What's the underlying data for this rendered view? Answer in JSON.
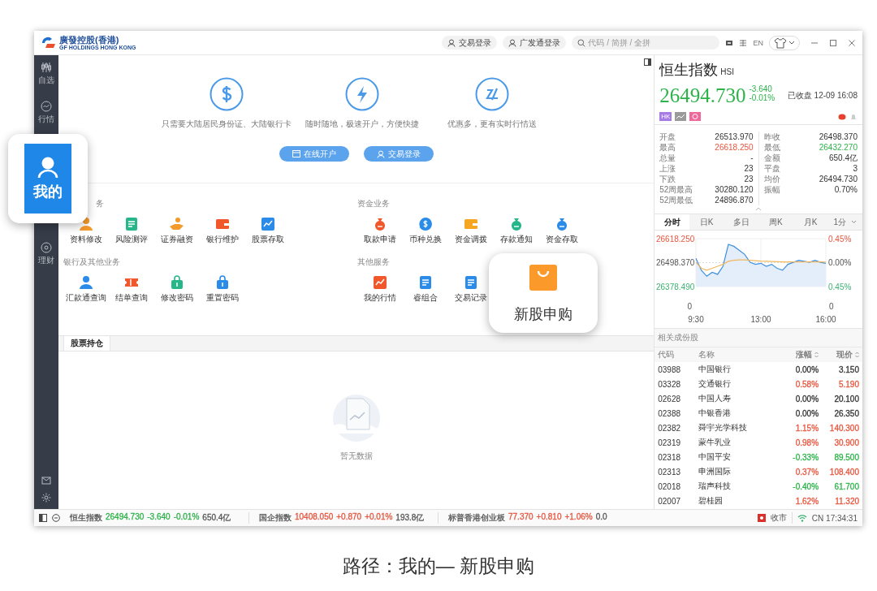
{
  "title_bar": {
    "logo": "廣發控股(香港)",
    "logo_sub": "GF HOLDINGS HONG KONG",
    "buttons": [
      "交易登录",
      "广发通登录"
    ],
    "search": {
      "placeholder": "代码 / 简拼 / 全拼"
    },
    "language": "EN"
  },
  "sidebar": {
    "items": [
      {
        "label": "自选"
      },
      {
        "label": "行情"
      },
      {
        "label": "理财"
      }
    ]
  },
  "promo": {
    "features": [
      {
        "text": "只需要大陆居民身份证、大陆银行卡"
      },
      {
        "text": "随时随地，极速开户，方便快捷"
      },
      {
        "text": "优惠多，更有实时行情送"
      }
    ],
    "buttons": [
      {
        "label": "在线开户"
      },
      {
        "label": "交易登录"
      }
    ]
  },
  "services": {
    "columns": [
      {
        "sections": [
          {
            "title": "务",
            "items": [
              {
                "label": "资料修改",
                "kind": "person",
                "color": "#f39a2c"
              },
              {
                "label": "风险测评",
                "kind": "doc",
                "color": "#27b58a"
              },
              {
                "label": "证券融资",
                "kind": "hand",
                "color": "#f39a2c"
              },
              {
                "label": "银行维护",
                "kind": "wallet",
                "color": "#f0582c"
              },
              {
                "label": "股票存取",
                "kind": "chart",
                "color": "#2a8be8"
              }
            ]
          },
          {
            "title": "银行及其他业务",
            "items": [
              {
                "label": "汇款通查询",
                "kind": "person",
                "color": "#2a8be8"
              },
              {
                "label": "结单查询",
                "kind": "ticket",
                "color": "#f0582c"
              },
              {
                "label": "修改密码",
                "kind": "lock",
                "color": "#27b58a"
              },
              {
                "label": "重置密码",
                "kind": "lock",
                "color": "#2a8be8"
              }
            ]
          }
        ]
      },
      {
        "sections": [
          {
            "title": "资金业务",
            "items": [
              {
                "label": "取款申请",
                "kind": "bag",
                "color": "#f0582c"
              },
              {
                "label": "币种兑换",
                "kind": "coin",
                "color": "#2a8be8"
              },
              {
                "label": "资金调拨",
                "kind": "wallet",
                "color": "#f5a623"
              },
              {
                "label": "存款通知",
                "kind": "bag",
                "color": "#27b58a"
              },
              {
                "label": "资金存取",
                "kind": "bag",
                "color": "#2a8be8"
              }
            ]
          },
          {
            "title": "其他服务",
            "items": [
              {
                "label": "我的行情",
                "kind": "chart",
                "color": "#f0582c"
              },
              {
                "label": "睿组合",
                "kind": "doc",
                "color": "#2a8be8"
              },
              {
                "label": "交易记录",
                "kind": "doc",
                "color": "#2a8be8"
              }
            ]
          }
        ]
      }
    ]
  },
  "holdings": {
    "tabs": [
      {
        "label": "股票持仓",
        "selected": true
      }
    ],
    "empty_text": "暂无数据"
  },
  "index": {
    "name": "恒生指数",
    "code": "HSI",
    "price": "26494.730",
    "change": "-3.640",
    "pct": "-0.01%",
    "color": "#2db34a",
    "status": "已收盘 12-09 16:08",
    "badges": [
      {
        "kind": "text",
        "label": "HK",
        "color": "#a77be6"
      },
      {
        "kind": "chart",
        "color": "#9a9a9a"
      },
      {
        "kind": "ring",
        "color": "#f0689a"
      }
    ],
    "stats": [
      [
        {
          "label": "开盘",
          "value": "26513.970"
        },
        {
          "label": "最高",
          "value": "26618.250",
          "color": "#e8553e"
        },
        {
          "label": "总量",
          "value": "-"
        },
        {
          "label": "上涨",
          "value": "23"
        },
        {
          "label": "下跌",
          "value": "23"
        },
        {
          "label": "52周最高",
          "value": "30280.120"
        },
        {
          "label": "52周最低",
          "value": "24896.870"
        }
      ],
      [
        {
          "label": "昨收",
          "value": "26498.370"
        },
        {
          "label": "最低",
          "value": "26432.270",
          "color": "#2db34a"
        },
        {
          "label": "金额",
          "value": "650.4亿"
        },
        {
          "label": "平盘",
          "value": "3"
        },
        {
          "label": "均价",
          "value": "26494.730"
        },
        {
          "label": "振幅",
          "value": "0.70%"
        }
      ]
    ],
    "chart_tabs": [
      {
        "label": "分时",
        "selected": true
      },
      {
        "label": "日K",
        "selected": false
      },
      {
        "label": "多日",
        "selected": false
      },
      {
        "label": "周K",
        "selected": false
      },
      {
        "label": "月K",
        "selected": false
      },
      {
        "label": "1分",
        "selected": false,
        "dropdown": true
      }
    ],
    "chart": {
      "chart_data": {
        "type": "area",
        "categories": [
          "9:30",
          null,
          null,
          null,
          null,
          null,
          null,
          null,
          null,
          null,
          null,
          null,
          "13:00",
          null,
          null,
          null,
          null,
          null,
          null,
          null,
          null,
          null,
          null,
          null,
          "16:00"
        ],
        "series": [
          {
            "color": "#3d8fe0",
            "values": [
              26520,
              26460,
              26430,
              26450,
              26440,
              26480,
              26590,
              26580,
              26560,
              26540,
              26500,
              26490,
              26495,
              26480,
              26490,
              26470,
              26460,
              26490,
              26500,
              26510,
              26505,
              26500,
              26510,
              26500,
              26495
            ]
          },
          {
            "color": "#f0b860",
            "type": "line",
            "values": [
              26500,
              26470,
              26460,
              26470,
              26480,
              26490,
              26505,
              26510,
              26512,
              26512,
              26510,
              26508,
              26506,
              26505,
              26504,
              26503,
              26502,
              26502,
              26502,
              26502,
              26502,
              26502,
              26502,
              26502,
              26501
            ]
          }
        ],
        "ylim": [
          26378.49,
          26618.25
        ],
        "yticks": [
          {
            "value": 26378.49,
            "label": "26378.490"
          },
          {
            "value": 26498.37,
            "label": "26498.370"
          },
          {
            "value": 26618.25,
            "label": "26618.250"
          }
        ]
      },
      "right_labels": [
        "0.45%",
        "0.00%",
        "0.45%"
      ],
      "volume_labels": [
        "0",
        "0"
      ]
    },
    "constituents": {
      "title": "相关成份股",
      "columns": [
        {
          "label": "代码",
          "sortable": false
        },
        {
          "label": "名称",
          "sortable": false
        },
        {
          "label": "涨幅",
          "sortable": true
        },
        {
          "label": "现价",
          "sortable": true
        }
      ],
      "rows": [
        {
          "code": "03988",
          "name": "中国银行",
          "pct": "0.00%",
          "price": "3.150"
        },
        {
          "code": "03328",
          "name": "交通银行",
          "pct": "0.58%",
          "price": "5.190",
          "color": "#e8553e"
        },
        {
          "code": "02628",
          "name": "中国人寿",
          "pct": "0.00%",
          "price": "20.100"
        },
        {
          "code": "02388",
          "name": "中银香港",
          "pct": "0.00%",
          "price": "26.350"
        },
        {
          "code": "02382",
          "name": "舜宇光学科技",
          "pct": "1.15%",
          "price": "140.300",
          "color": "#e8553e"
        },
        {
          "code": "02319",
          "name": "蒙牛乳业",
          "pct": "0.98%",
          "price": "30.900",
          "color": "#e8553e"
        },
        {
          "code": "02318",
          "name": "中国平安",
          "pct": "-0.33%",
          "price": "89.500",
          "color": "#2db34a"
        },
        {
          "code": "02313",
          "name": "申洲国际",
          "pct": "0.37%",
          "price": "108.400",
          "color": "#e8553e"
        },
        {
          "code": "02018",
          "name": "瑞声科技",
          "pct": "-0.40%",
          "price": "61.700",
          "color": "#2db34a"
        },
        {
          "code": "02007",
          "name": "碧桂园",
          "pct": "1.62%",
          "price": "11.320",
          "color": "#e8553e"
        }
      ]
    }
  },
  "status_bar": {
    "tickers": [
      {
        "name": "恒生指数",
        "price": "26494.730",
        "change": "-3.640",
        "pct": "-0.01%",
        "amount": "650.4亿",
        "color": "#2db34a"
      },
      {
        "name": "国企指数",
        "price": "10408.050",
        "change": "+0.870",
        "pct": "+0.01%",
        "amount": "193.8亿",
        "color": "#e8553e"
      },
      {
        "name": "标普香港创业板",
        "price": "77.370",
        "change": "+0.810",
        "pct": "+1.06%",
        "amount": "0.0",
        "color": "#e8553e"
      }
    ],
    "market": "收市",
    "clock": "CN 17:34:31"
  },
  "callouts": [
    {
      "kind": "mine",
      "label": "我的"
    },
    {
      "kind": "ipo",
      "label": "新股申购"
    }
  ],
  "caption": "路径：我的— 新股申购"
}
